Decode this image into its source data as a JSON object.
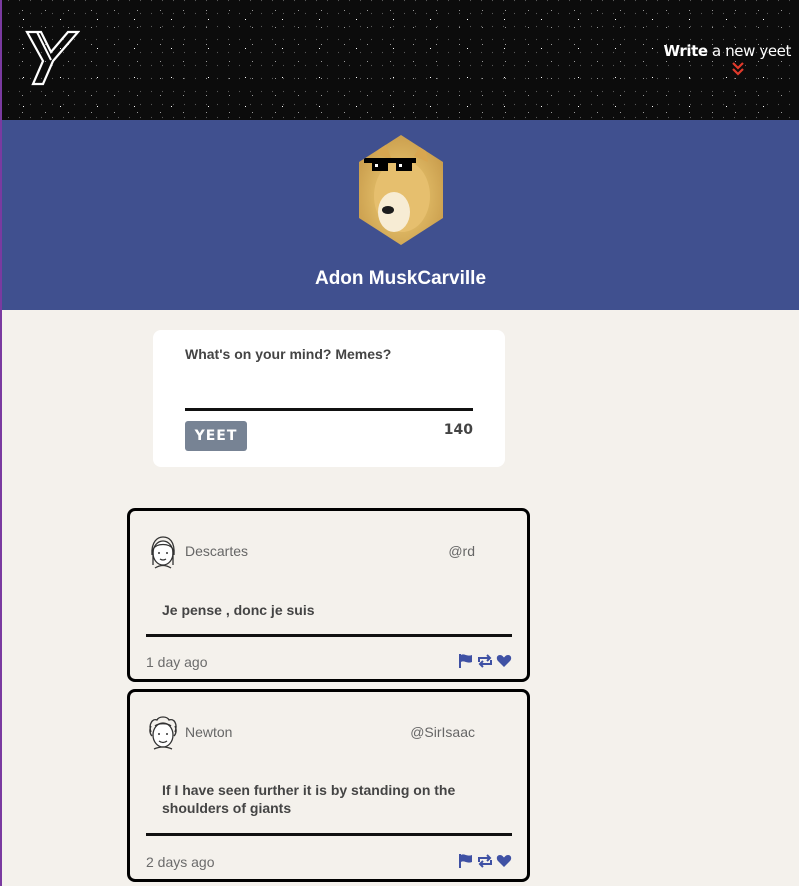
{
  "header": {
    "compose_link_bold": "Write",
    "compose_link_rest": " a new yeet"
  },
  "profile": {
    "name": "Adon MuskCarville"
  },
  "composer": {
    "placeholder": "What's on your mind? Memes?",
    "submit_label": "YEET",
    "char_count": "140"
  },
  "tweets": [
    {
      "name": "Descartes",
      "handle": "@rd",
      "text": "Je pense , donc je suis",
      "time": "1 day ago"
    },
    {
      "name": "Newton",
      "handle": "@SirIsaac",
      "text": "If I have seen further it is by standing on the shoulders of giants",
      "time": "2 days ago"
    }
  ],
  "colors": {
    "profile_band": "#40508f",
    "accent_blue": "#3f51a4",
    "chevron": "#e0392b",
    "button": "#778394"
  },
  "icons": {
    "logo": "y-logo",
    "compose_indicator": "double-chevron-down-icon",
    "actions": [
      "flag-icon",
      "retweet-icon",
      "heart-icon"
    ]
  }
}
